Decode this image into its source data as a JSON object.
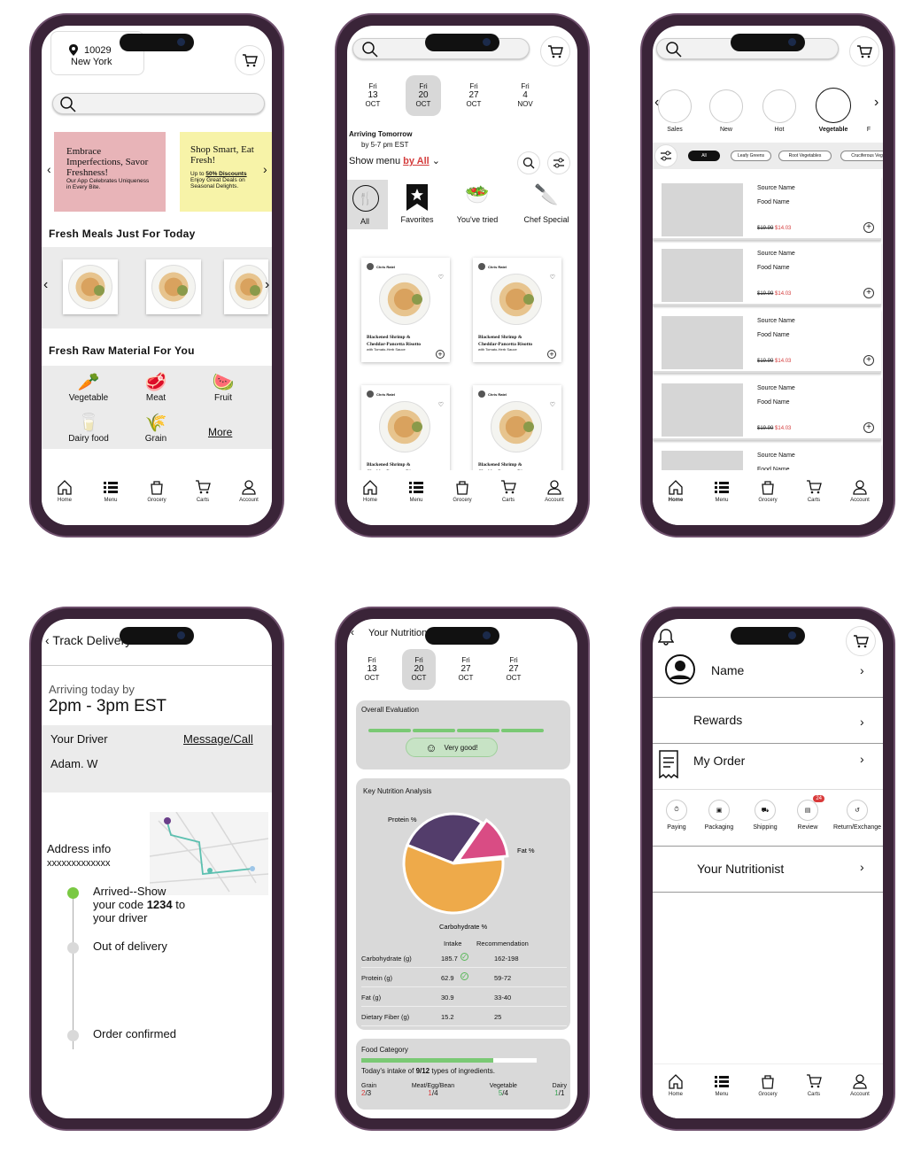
{
  "nav": {
    "home": "Home",
    "menu": "Menu",
    "grocery": "Grocery",
    "carts": "Carts",
    "account": "Account"
  },
  "screen1": {
    "zip": "10029",
    "city": "New York",
    "banner1": {
      "title": "Embrace Imperfections, Savor Freshness!",
      "body": "Our App Celebrates Uniqueness in Every Bite."
    },
    "banner2": {
      "title": "Shop Smart, Eat Fresh!",
      "up_to": "Up to ",
      "discount": "50% Discounts",
      "body": "Enjoy Great Deals on Seasonal Delights."
    },
    "section_meals": "Fresh Meals Just For Today",
    "section_raw": "Fresh Raw Material For You",
    "categories": [
      "Vegetable",
      "Meat",
      "Fruit",
      "Dairy food",
      "Grain"
    ],
    "more": "More"
  },
  "screen2": {
    "dates": [
      {
        "d": "Fri",
        "n": "13",
        "m": "OCT"
      },
      {
        "d": "Fri",
        "n": "20",
        "m": "OCT"
      },
      {
        "d": "Fri",
        "n": "27",
        "m": "OCT"
      },
      {
        "d": "Fri",
        "n": "4",
        "m": "NOV"
      }
    ],
    "arriving": "Arriving Tomorrow",
    "time": "by 5-7 pm EST",
    "show_menu": "Show menu ",
    "by_all": "by All",
    "tabs": [
      "All",
      "Favorites",
      "You've tried",
      "Chef Special"
    ],
    "card": {
      "chef": "Chris Ratel",
      "title1": "Blackened Shrimp &",
      "title2": "Cheddar-Pancetta Risotto",
      "sub": "with Tomato-Herb Sauce"
    }
  },
  "screen3": {
    "cats": [
      "Sales",
      "New",
      "Hot",
      "Vegetable",
      "F"
    ],
    "chips": [
      "All",
      "Leafy Greens",
      "Root Vegetables",
      "Cruciferous Veg"
    ],
    "item": {
      "source": "Source Name",
      "food": "Food Name",
      "old": "$19.99",
      "new": "$14.03"
    }
  },
  "screen4": {
    "title": "Track Delivery",
    "arriving": "Arriving today by",
    "window": "2pm - 3pm EST",
    "driver_label": "Your Driver",
    "contact": "Message/Call",
    "driver": "Adam. W",
    "address": "Address info",
    "address_val": "xxxxxxxxxxxxx",
    "step1a": "Arrived--Show",
    "step1b": "your code ",
    "code": "1234",
    "step1c": " to",
    "step1d": "your driver",
    "step2": "Out of delivery",
    "step3": "Order confirmed",
    "colors": {
      "done": "#7ac943",
      "pending": "#d9d9d9"
    }
  },
  "screen5": {
    "title": "Your Nutrition",
    "dates": [
      {
        "d": "Fri",
        "n": "13",
        "m": "OCT"
      },
      {
        "d": "Fri",
        "n": "20",
        "m": "OCT"
      },
      {
        "d": "Fri",
        "n": "27",
        "m": "OCT"
      },
      {
        "d": "Fri",
        "n": "27",
        "m": "OCT"
      }
    ],
    "overall": "Overall Evaluation",
    "verdict": "Very good!",
    "key": "Key Nutrition Analysis",
    "head_intake": "Intake",
    "head_rec": "Recommendation",
    "rows": [
      {
        "name": "Carbohydrate (g)",
        "intake": "185.7",
        "rec": "162-198"
      },
      {
        "name": "Protein (g)",
        "intake": "62.9",
        "rec": "59-72"
      },
      {
        "name": "Fat (g)",
        "intake": "30.9",
        "rec": "33-40"
      },
      {
        "name": "Dietary Fiber (g)",
        "intake": "15.2",
        "rec": "25"
      }
    ],
    "food_category": "Food Category",
    "intake_pre": "Today's intake of ",
    "intake_val": "9/12",
    "intake_post": " types of ingredients.",
    "fc": [
      {
        "name": "Grain",
        "a": "2",
        "b": "/3",
        "c": "#d93a3a"
      },
      {
        "name": "Meat/Egg/Bean",
        "a": "1",
        "b": "/4",
        "c": "#d93a3a"
      },
      {
        "name": "Vegetable",
        "a": "5",
        "b": "/4",
        "c": "#3aa655"
      },
      {
        "name": "Dairy",
        "a": "1",
        "b": "/1",
        "c": "#3aa655"
      }
    ],
    "food_category_progress": 0.75
  },
  "chart_data": {
    "type": "pie",
    "title": "",
    "categories": [
      "Protein %",
      "Fat %",
      "Carbohydrate %"
    ],
    "values": [
      25,
      12,
      50
    ],
    "colors": [
      "#533d6b",
      "#d94c84",
      "#eeaa4a"
    ]
  },
  "screen6": {
    "name": "Name",
    "rewards": "Rewards",
    "my_order": "My Order",
    "services": [
      "Paying",
      "Packaging",
      "Shipping",
      "Review",
      "Return/Exchange"
    ],
    "review_badge": "24",
    "nutritionist": "Your Nutritionist"
  }
}
